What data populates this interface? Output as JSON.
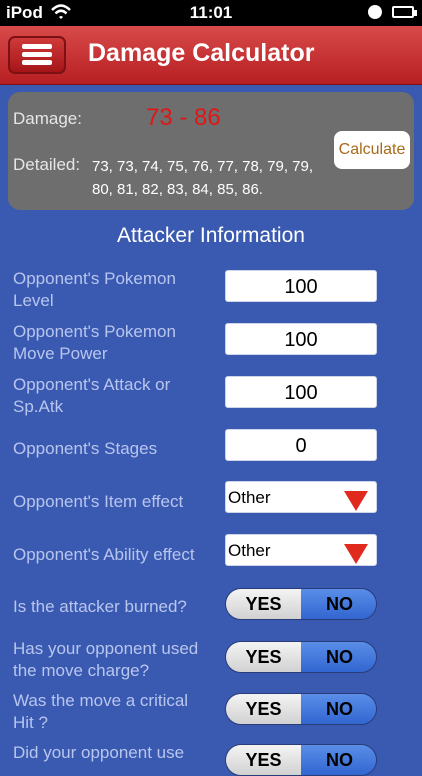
{
  "status": {
    "carrier": "iPod",
    "time": "11:01"
  },
  "navbar": {
    "title": "Damage Calculator"
  },
  "result": {
    "damage_label": "Damage:",
    "damage_value": "73 - 86",
    "detailed_label": "Detailed:",
    "detailed_value": "73, 73, 74, 75, 76, 77, 78, 79, 79, 80, 81, 82, 83, 84, 85, 86.",
    "calculate_label": "Calculate"
  },
  "section": {
    "title": "Attacker Information"
  },
  "fields": {
    "level": {
      "label": "Opponent's Pokemon Level",
      "value": "100"
    },
    "move_power": {
      "label": "Opponent's Pokemon Move Power",
      "value": "100"
    },
    "attack": {
      "label": "Opponent's Attack or Sp.Atk",
      "value": "100"
    },
    "stages": {
      "label": "Opponent's Stages",
      "value": "0"
    },
    "item": {
      "label": "Opponent's Item effect",
      "value": "Other"
    },
    "ability": {
      "label": "Opponent's Ability effect",
      "value": "Other"
    }
  },
  "toggles": {
    "burned": {
      "label": "Is the attacker burned?",
      "yes": "YES",
      "no": "NO"
    },
    "charge": {
      "label": "Has your opponent used the move charge?",
      "yes": "YES",
      "no": "NO"
    },
    "critical": {
      "label": "Was the move a critical Hit ?",
      "yes": "YES",
      "no": "NO"
    },
    "partial": {
      "label": "Did your opponent use",
      "yes": "YES",
      "no": "NO"
    }
  },
  "colors": {
    "nav_red": "#c22a2d",
    "background": "#3a59b0",
    "damage_red": "#e01616",
    "toggle_blue": "#2f63cf"
  }
}
